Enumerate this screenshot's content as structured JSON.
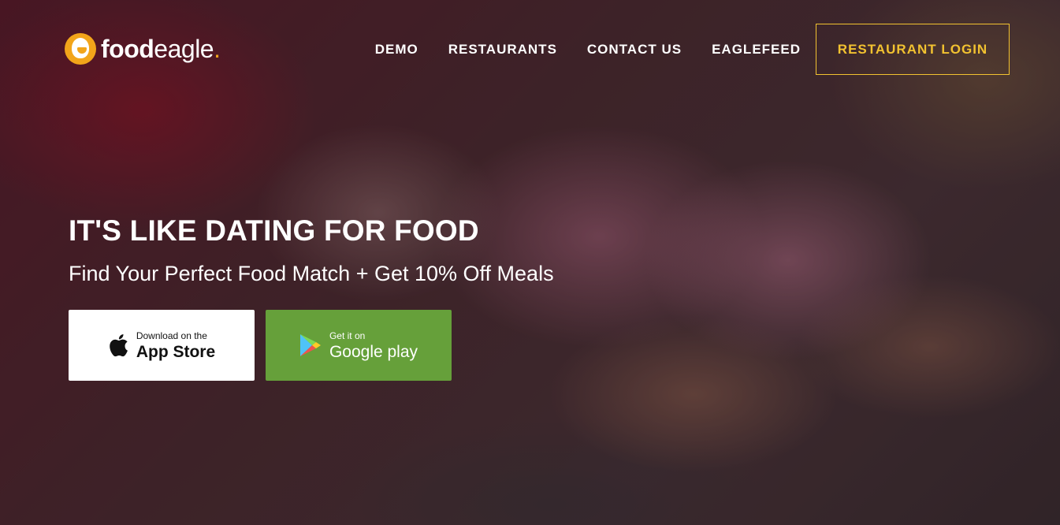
{
  "brand": {
    "name_bold": "food",
    "name_light": "eagle",
    "name_dot": ".",
    "accent_color": "#f2a51a"
  },
  "nav": {
    "items": [
      {
        "label": "DEMO"
      },
      {
        "label": "RESTAURANTS"
      },
      {
        "label": "CONTACT US"
      },
      {
        "label": "EAGLEFEED"
      }
    ],
    "cta_label": "RESTAURANT LOGIN",
    "cta_color": "#f2c230"
  },
  "hero": {
    "headline": "IT'S LIKE DATING FOR FOOD",
    "subheadline": "Find Your Perfect Food Match + Get 10% Off Meals"
  },
  "downloads": {
    "app_store": {
      "small": "Download on the",
      "big": "App Store",
      "icon": "apple-icon"
    },
    "google_play": {
      "small": "Get it on",
      "big": "Google play",
      "icon": "google-play-icon",
      "bg_color": "#66a03a"
    }
  }
}
